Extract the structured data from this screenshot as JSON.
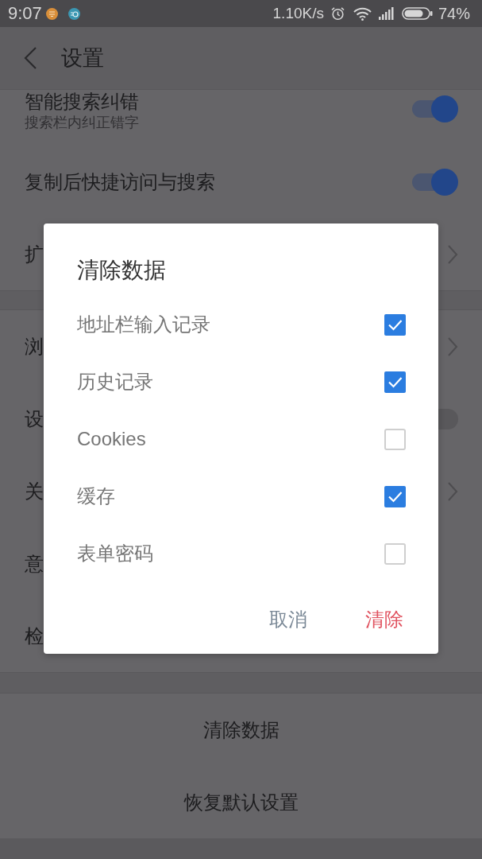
{
  "status_bar": {
    "time": "9:07",
    "net_speed": "1.10K/s",
    "battery": "74%"
  },
  "app_bar": {
    "title": "设置"
  },
  "sections": [
    {
      "rows": [
        {
          "kind": "toggle",
          "label": "智能搜索纠错",
          "description": "搜索栏内纠正错字",
          "on": true
        },
        {
          "kind": "toggle",
          "label": "复制后快捷访问与搜索",
          "on": true
        },
        {
          "kind": "link",
          "label": "扩"
        }
      ]
    },
    {
      "rows": [
        {
          "kind": "link",
          "label": "浏"
        },
        {
          "kind": "toggle",
          "label": "设",
          "on": false
        },
        {
          "kind": "link",
          "label": "关"
        },
        {
          "kind": "plain",
          "label": "意"
        },
        {
          "kind": "plain",
          "label": "检"
        }
      ]
    },
    {
      "rows": [
        {
          "kind": "action",
          "label": "清除数据"
        },
        {
          "kind": "action",
          "label": "恢复默认设置"
        }
      ]
    }
  ],
  "dialog": {
    "title": "清除数据",
    "options": [
      {
        "label": "地址栏输入记录",
        "checked": true
      },
      {
        "label": "历史记录",
        "checked": true
      },
      {
        "label": "Cookies",
        "checked": false
      },
      {
        "label": "缓存",
        "checked": true
      },
      {
        "label": "表单密码",
        "checked": false
      }
    ],
    "buttons": [
      {
        "kind": "cancel",
        "label": "取消"
      },
      {
        "kind": "confirm",
        "label": "清除"
      }
    ]
  }
}
